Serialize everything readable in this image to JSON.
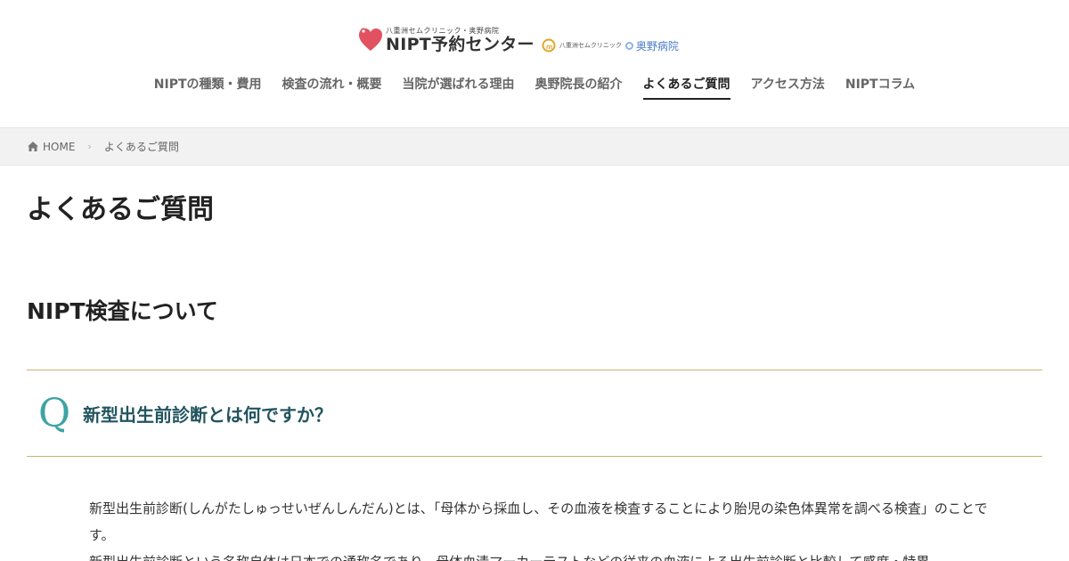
{
  "header": {
    "logo": {
      "small_text": "八重洲セムクリニック・奥野病院",
      "main_text": "NIPT予約センター",
      "partner_sem": "八重洲セムクリニック",
      "partner_okuno": "奥野病院"
    },
    "nav": [
      {
        "label": "NIPTの種類・費用"
      },
      {
        "label": "検査の流れ・概要"
      },
      {
        "label": "当院が選ばれる理由"
      },
      {
        "label": "奥野院長の紹介"
      },
      {
        "label": "よくあるご質問"
      },
      {
        "label": "アクセス方法"
      },
      {
        "label": "NIPTコラム"
      }
    ],
    "active_nav_index": 4
  },
  "breadcrumb": {
    "home": "HOME",
    "current": "よくあるご質問"
  },
  "page": {
    "title": "よくあるご質問",
    "section_title": "NIPT検査について",
    "question": {
      "mark": "Q",
      "text": "新型出生前診断とは何ですか？"
    },
    "answer": [
      "新型出生前診断(しんがたしゅっせいぜんしんだん)とは、「母体から採血し、その血液を検査することにより胎児の染色体異常を調べる検査」のことです。",
      "新型出生前診断という名称自体は日本での通称名であり、母体血清マーカーテストなどの従来の血液による出生前診断と比較して感度・特異"
    ]
  },
  "colors": {
    "accent_gold": "#c8b66a",
    "q_mark_teal": "#3fa3a3",
    "question_text": "#22555e",
    "logo_heart": "#e2515f"
  }
}
